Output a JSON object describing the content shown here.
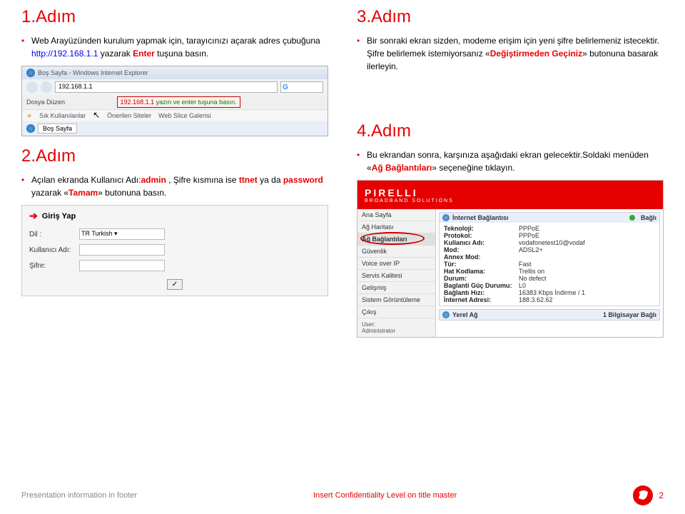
{
  "steps": {
    "s1_title": "1.Adım",
    "s2_title": "2.Adım",
    "s3_title": "3.Adım",
    "s4_title": "4.Adım"
  },
  "s1": {
    "pre": "Web Arayüzünden kurulum yapmak için, tarayıcınızı açarak adres çubuğuna ",
    "url": "http://192.168.1.1",
    "mid": " yazarak ",
    "enter": "Enter",
    "post": " tuşuna basın."
  },
  "s2": {
    "pre": "Açılan ekranda Kullanıcı Adı:",
    "admin": "admin",
    "mid1": " , Şifre kısmına ise ",
    "ttnet": "ttnet",
    "mid2": " ya da ",
    "password": "password",
    "mid3": " yazarak «",
    "tamam": "Tamam",
    "post": "» butonuna basın."
  },
  "s3": {
    "line1": "Bir sonraki ekran sizden, modeme erişim için yeni şifre belirlemeniz istecektir. Şifre belirlemek istemiyorsanız «",
    "btn": "Değiştirmeden Geçiniz",
    "line2": "» butonuna basarak ilerleyin."
  },
  "s4": {
    "line1": "Bu ekrandan sonra, karşınıza aşağıdaki ekran gelecektir.Soldaki menüden «",
    "btn": "Ağ Bağlantıları",
    "line2": "» seçeneğine tıklayın."
  },
  "browser": {
    "title": "Boş Sayfa - Windows Internet Explorer",
    "addr": "192.168.1.1",
    "menu": "Dosya    Düzen",
    "callout_addr": "192.168.1.1",
    "callout_hint": " yazın ve enter tuşuna basın.",
    "fav": "Sık Kullanılanlar",
    "fav2": "Önerilen Siteler",
    "fav3": "Web Slice Galerisi",
    "tab": "Boş Sayfa"
  },
  "login": {
    "title": "Giriş Yap",
    "dil_label": "Dil :",
    "dil_value": "TR Turkish ▾",
    "user_label": "Kullanıcı Adı:",
    "pass_label": "Şifre:",
    "ok_icon": "✓"
  },
  "pirelli": {
    "brand": "PIRELLI",
    "sub": "BROADBAND SOLUTIONS",
    "nav": [
      "Ana Sayfa",
      "Ağ Haritası",
      "Ağ Bağlantıları",
      "Güvenlik",
      "Voice over IP",
      "Servis Kalitesi",
      "Gelişmiş",
      "Sistem Görüntüleme",
      "Çıkış"
    ],
    "user_lbl": "User:",
    "user_val": "Administrator",
    "panel1_title": "İnternet Bağlantısı",
    "panel1_status": "Bağlı",
    "kv": [
      [
        "Teknoloji:",
        "PPPoE"
      ],
      [
        "Protokol:",
        "PPPoE"
      ],
      [
        "Kullanıcı Adı:",
        "vodafonetest10@vodaf"
      ],
      [
        "Mod:",
        "ADSL2+"
      ],
      [
        "Annex Mod:",
        ""
      ],
      [
        "Tür:",
        "Fast"
      ],
      [
        "Hat Kodlama:",
        "Trellis on"
      ],
      [
        "Durum:",
        "No defect"
      ],
      [
        "Baglanti Güç Durumu:",
        "L0"
      ],
      [
        "Bağlantı Hızı:",
        "16383 Kbps İndirme / 1"
      ],
      [
        "İnternet Adresi:",
        "188.3.62.62"
      ]
    ],
    "panel2_title": "Yerel Ağ",
    "panel2_status": "1 Bilgisayar Bağlı"
  },
  "footer": {
    "left": "Presentation information in footer",
    "center": "Insert Confidentiality Level on title master",
    "page": "2"
  }
}
